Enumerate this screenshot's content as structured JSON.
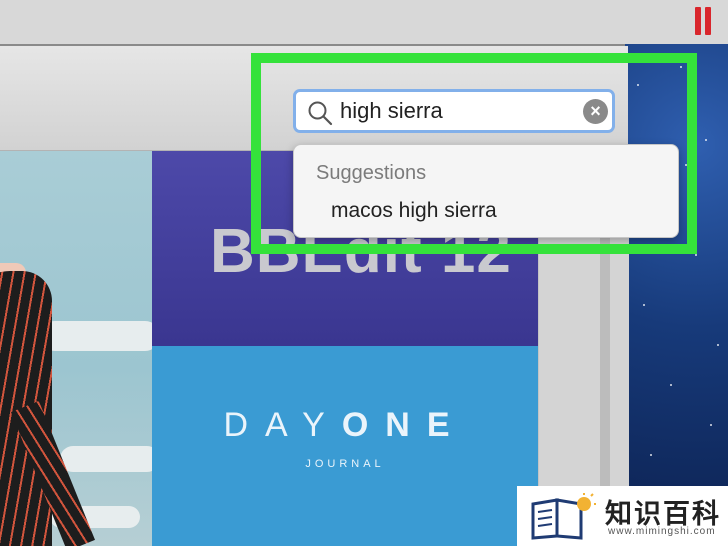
{
  "search": {
    "query": "high sierra",
    "clear_icon": "clear-x-icon",
    "search_icon": "magnifying-glass-icon"
  },
  "suggestions": {
    "header": "Suggestions",
    "items": [
      "macos high sierra"
    ]
  },
  "featured": {
    "bbedit_title": "BBEdit 12",
    "dayone_logo_light": "DAY",
    "dayone_logo_bold": "ONE",
    "dayone_logo_last": "E",
    "dayone_subtitle": "JOURNAL"
  },
  "watermark": {
    "title": "知识百科",
    "url": "www.mimingshi.com"
  },
  "colors": {
    "highlight": "#35e23b",
    "search_focus": "#82b0ea",
    "marker": "#d9262c",
    "bbedit_bg": "#4d49a9",
    "dayone_bg": "#3a9bd3"
  }
}
